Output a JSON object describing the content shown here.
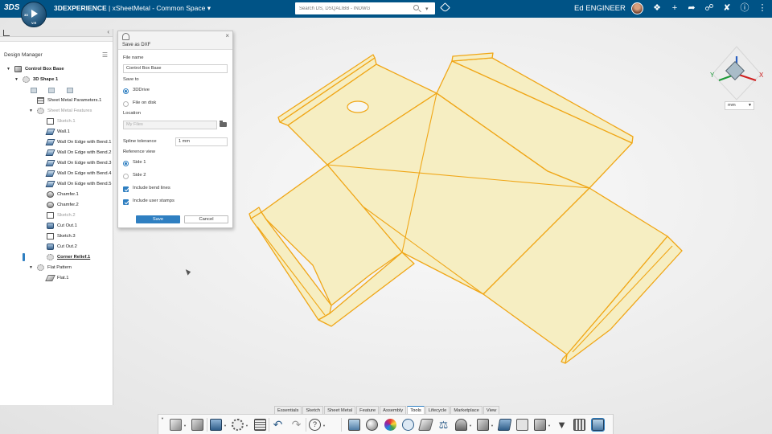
{
  "app": {
    "brand": "3DEXPERIENCE",
    "separator": " | ",
    "title": "xSheetMetal - Common Space",
    "compass_labels": [
      "3D",
      "V.R"
    ]
  },
  "search": {
    "placeholder": "Search DS, DSQALIBB - INDWG"
  },
  "user": {
    "name": "Ed ENGINEER"
  },
  "top_icons": [
    "tag-icon",
    "comment-icon",
    "plus-icon",
    "share-icon",
    "network-icon",
    "tools-icon",
    "help-icon",
    "menu-icon"
  ],
  "design_manager": {
    "title": "Design Manager",
    "tree": [
      {
        "label": "Control Box Base",
        "level": 0,
        "icon": "box-icon",
        "state": "bold",
        "expanded": true
      },
      {
        "label": "3D Shape 1",
        "level": 1,
        "icon": "shape-icon",
        "state": "bold",
        "expanded": true
      },
      {
        "label": "Sheet Metal Parameters.1",
        "level": 2,
        "icon": "parameters-icon",
        "state": "normal"
      },
      {
        "label": "Sheet Metal Features",
        "level": 2,
        "icon": "gear-icon",
        "state": "dim",
        "expanded": true
      },
      {
        "label": "Sketch.1",
        "level": 3,
        "icon": "sketch-icon",
        "state": "dim"
      },
      {
        "label": "Wall.1",
        "level": 3,
        "icon": "wall-icon",
        "state": "normal"
      },
      {
        "label": "Wall On Edge with Bend.1",
        "level": 3,
        "icon": "wall-icon",
        "state": "normal"
      },
      {
        "label": "Wall On Edge with Bend.2",
        "level": 3,
        "icon": "wall-icon",
        "state": "normal"
      },
      {
        "label": "Wall On Edge with Bend.3",
        "level": 3,
        "icon": "wall-icon",
        "state": "normal"
      },
      {
        "label": "Wall On Edge with Bend.4",
        "level": 3,
        "icon": "wall-icon",
        "state": "normal"
      },
      {
        "label": "Wall On Edge with Bend.5",
        "level": 3,
        "icon": "wall-icon",
        "state": "normal"
      },
      {
        "label": "Chamfer.1",
        "level": 3,
        "icon": "chamfer-icon",
        "state": "normal"
      },
      {
        "label": "Chamfer.2",
        "level": 3,
        "icon": "chamfer-icon",
        "state": "normal"
      },
      {
        "label": "Sketch.2",
        "level": 3,
        "icon": "sketch-icon",
        "state": "dim"
      },
      {
        "label": "Cut Out.1",
        "level": 3,
        "icon": "cutout-icon",
        "state": "normal"
      },
      {
        "label": "Sketch.3",
        "level": 3,
        "icon": "sketch-icon",
        "state": "normal"
      },
      {
        "label": "Cut Out.2",
        "level": 3,
        "icon": "cutout-icon",
        "state": "normal"
      },
      {
        "label": "Corner Relief.1",
        "level": 3,
        "icon": "corner-relief-icon",
        "state": "current"
      },
      {
        "label": "Flat Pattern",
        "level": 2,
        "icon": "gear-icon",
        "state": "normal",
        "expanded": true
      },
      {
        "label": "Flat.1",
        "level": 3,
        "icon": "flat-icon",
        "state": "normal"
      }
    ]
  },
  "dialog": {
    "title": "Save as DXF",
    "file_name_label": "File name",
    "file_name_value": "Control Box Base",
    "save_to_label": "Save to",
    "save_to_options": [
      "3DDrive",
      "File on disk"
    ],
    "save_to_selected": "3DDrive",
    "location_label": "Location",
    "location_value": "My Files",
    "spline_label": "Spline tolerance",
    "spline_value": "1 mm",
    "reference_view_label": "Reference view",
    "reference_view_options": [
      "Side 1",
      "Side 2"
    ],
    "reference_view_selected": "Side 1",
    "include_bend_lines": "Include bend lines",
    "include_user_stamps": "Include user stamps",
    "bend_lines_checked": true,
    "user_stamps_checked": true,
    "save_label": "Save",
    "cancel_label": "Cancel"
  },
  "viewer": {
    "units": "mm",
    "part_fill": "#f6eec2",
    "part_edge": "#f0a616",
    "compass_axes": [
      "X",
      "Y",
      "Z"
    ]
  },
  "toolbar": {
    "tabs": [
      "Essentials",
      "Sketch",
      "Sheet Metal",
      "Feature",
      "Assembly",
      "Tools",
      "Lifecycle",
      "Marketplace",
      "View"
    ],
    "active_tab": "Tools"
  },
  "colors": {
    "top_bar": "#005386",
    "accent": "#2f7fc1"
  }
}
